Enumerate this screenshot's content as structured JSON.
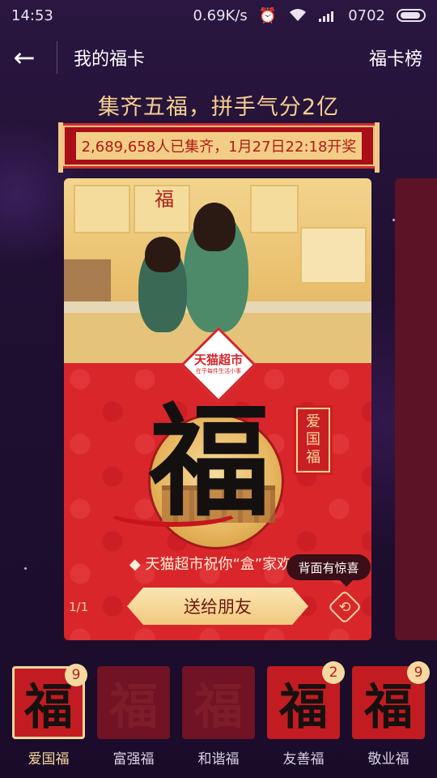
{
  "status_bar": {
    "time": "14:53",
    "speed": "0.69K/s",
    "alarm_icon": "alarm-icon",
    "wifi_icon": "wifi-icon",
    "signal_icon": "signal-icon",
    "clock_right": "0702",
    "battery_icon": "battery-icon"
  },
  "nav": {
    "back_icon": "←",
    "title": "我的福卡",
    "right_link": "福卡榜"
  },
  "headline": "集齐五福，拼手气分2亿",
  "banner": "2,689,658人已集齐，1月27日22:18开奖",
  "card": {
    "logo_main": "天猫超市",
    "logo_sub": "在乎每件生活小事",
    "fu_glyph": "福",
    "tag": [
      "爱",
      "国",
      "福"
    ],
    "greeting": "◆ 天猫超市祝你“盒”家欢乐",
    "tooltip": "背面有惊喜",
    "counter": "1/1",
    "send_button": "送给朋友",
    "flip_icon": "refresh-icon"
  },
  "fu_cards": [
    {
      "glyph": "福",
      "name": "爱国福",
      "badge": "9",
      "active": true,
      "dim": false
    },
    {
      "glyph": "福",
      "name": "富强福",
      "badge": "",
      "active": false,
      "dim": true
    },
    {
      "glyph": "福",
      "name": "和谐福",
      "badge": "",
      "active": false,
      "dim": true
    },
    {
      "glyph": "福",
      "name": "友善福",
      "badge": "2",
      "active": false,
      "dim": false
    },
    {
      "glyph": "福",
      "name": "敬业福",
      "badge": "9",
      "active": false,
      "dim": false
    }
  ],
  "colors": {
    "background": "#1c0f2b",
    "accent_gold": "#f6cf8f",
    "card_red": "#d6262b",
    "banner_red": "#a90e19"
  }
}
